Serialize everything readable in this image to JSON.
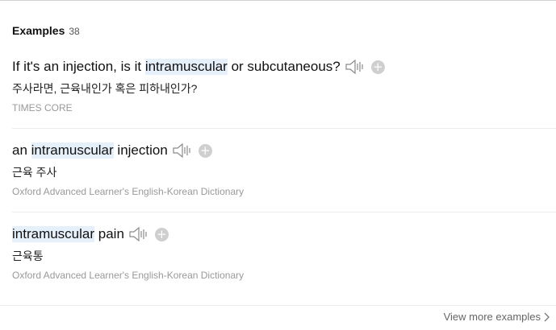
{
  "section": {
    "title": "Examples",
    "count": "38"
  },
  "examples": [
    {
      "en_before": "If it's an injection, is it ",
      "en_highlight": "intramuscular",
      "en_after": " or subcutaneous?",
      "ko": "주사라면, 근육내인가 혹은 피하내인가?",
      "source": "TIMES CORE"
    },
    {
      "en_before": "an ",
      "en_highlight": "intramuscular",
      "en_after": " injection",
      "ko": "근육 주사",
      "source": "Oxford Advanced Learner's English-Korean Dictionary"
    },
    {
      "en_before": "",
      "en_highlight": "intramuscular",
      "en_after": " pain",
      "ko": "근육통",
      "source": "Oxford Advanced Learner's English-Korean Dictionary"
    }
  ],
  "icons": {
    "speaker": "speaker-icon",
    "add": "add-icon",
    "more": "chevron-right-icon",
    "add_glyph": "+"
  },
  "footer": {
    "more_label": "View more examples"
  },
  "colors": {
    "highlight": "#e6f0fa",
    "add_button": "#cfcfcf",
    "source_text": "#999999"
  }
}
